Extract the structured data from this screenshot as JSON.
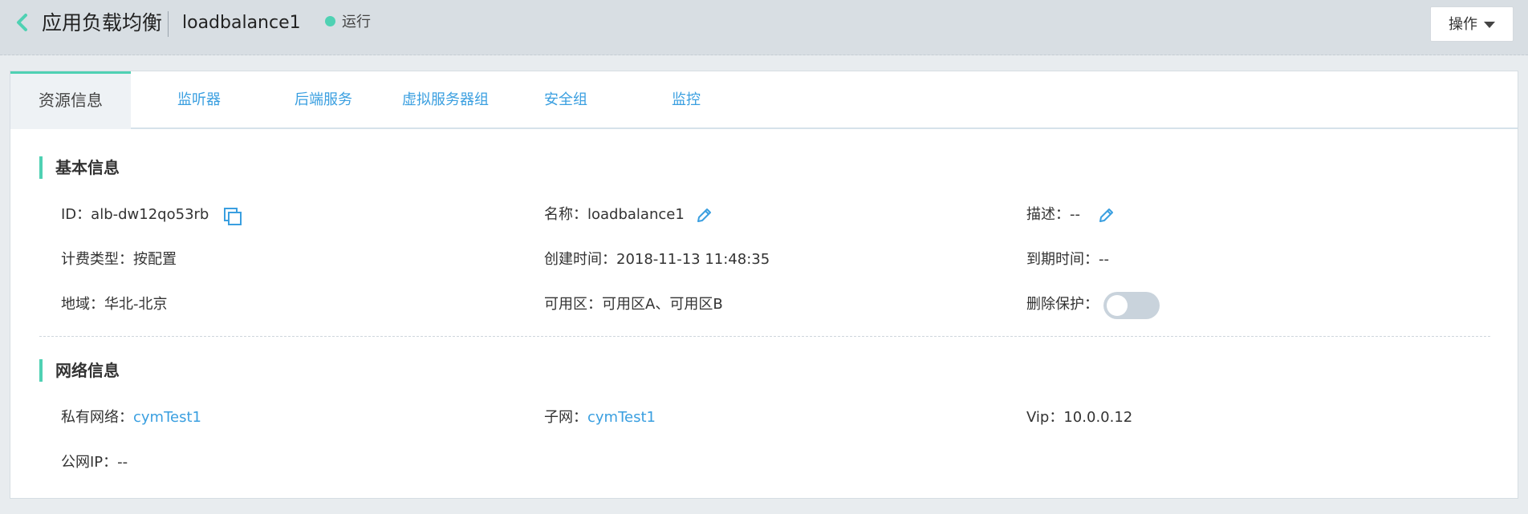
{
  "header": {
    "title": "应用负载均衡",
    "lb_name": "loadbalance1",
    "status": "运行",
    "operations_label": "操作"
  },
  "tabs": [
    {
      "label": "资源信息",
      "active": true
    },
    {
      "label": "监听器"
    },
    {
      "label": "后端服务"
    },
    {
      "label": "虚拟服务器组"
    },
    {
      "label": "安全组"
    },
    {
      "label": "监控"
    }
  ],
  "basic": {
    "section_title": "基本信息",
    "id_label": "ID：",
    "id_value": "alb-dw12qo53rb",
    "name_label": "名称：",
    "name_value": "loadbalance1",
    "desc_label": "描述：",
    "desc_value": "--",
    "billing_label": "计费类型：",
    "billing_value": "按配置",
    "created_label": "创建时间：",
    "created_value": "2018-11-13 11:48:35",
    "expire_label": "到期时间：",
    "expire_value": "--",
    "region_label": "地域：",
    "region_value": "华北-北京",
    "az_label": "可用区：",
    "az_value": "可用区A、可用区B",
    "delete_protect_label": "删除保护：",
    "delete_protect_on": false
  },
  "network": {
    "section_title": "网络信息",
    "vpc_label": "私有网络：",
    "vpc_value": "cymTest1",
    "subnet_label": "子网：",
    "subnet_value": "cymTest1",
    "vip_label": "Vip：",
    "vip_value": "10.0.0.12",
    "public_ip_label": "公网IP：",
    "public_ip_value": "--"
  },
  "colors": {
    "accent": "#4fd1b3",
    "link": "#3a9fe0"
  }
}
